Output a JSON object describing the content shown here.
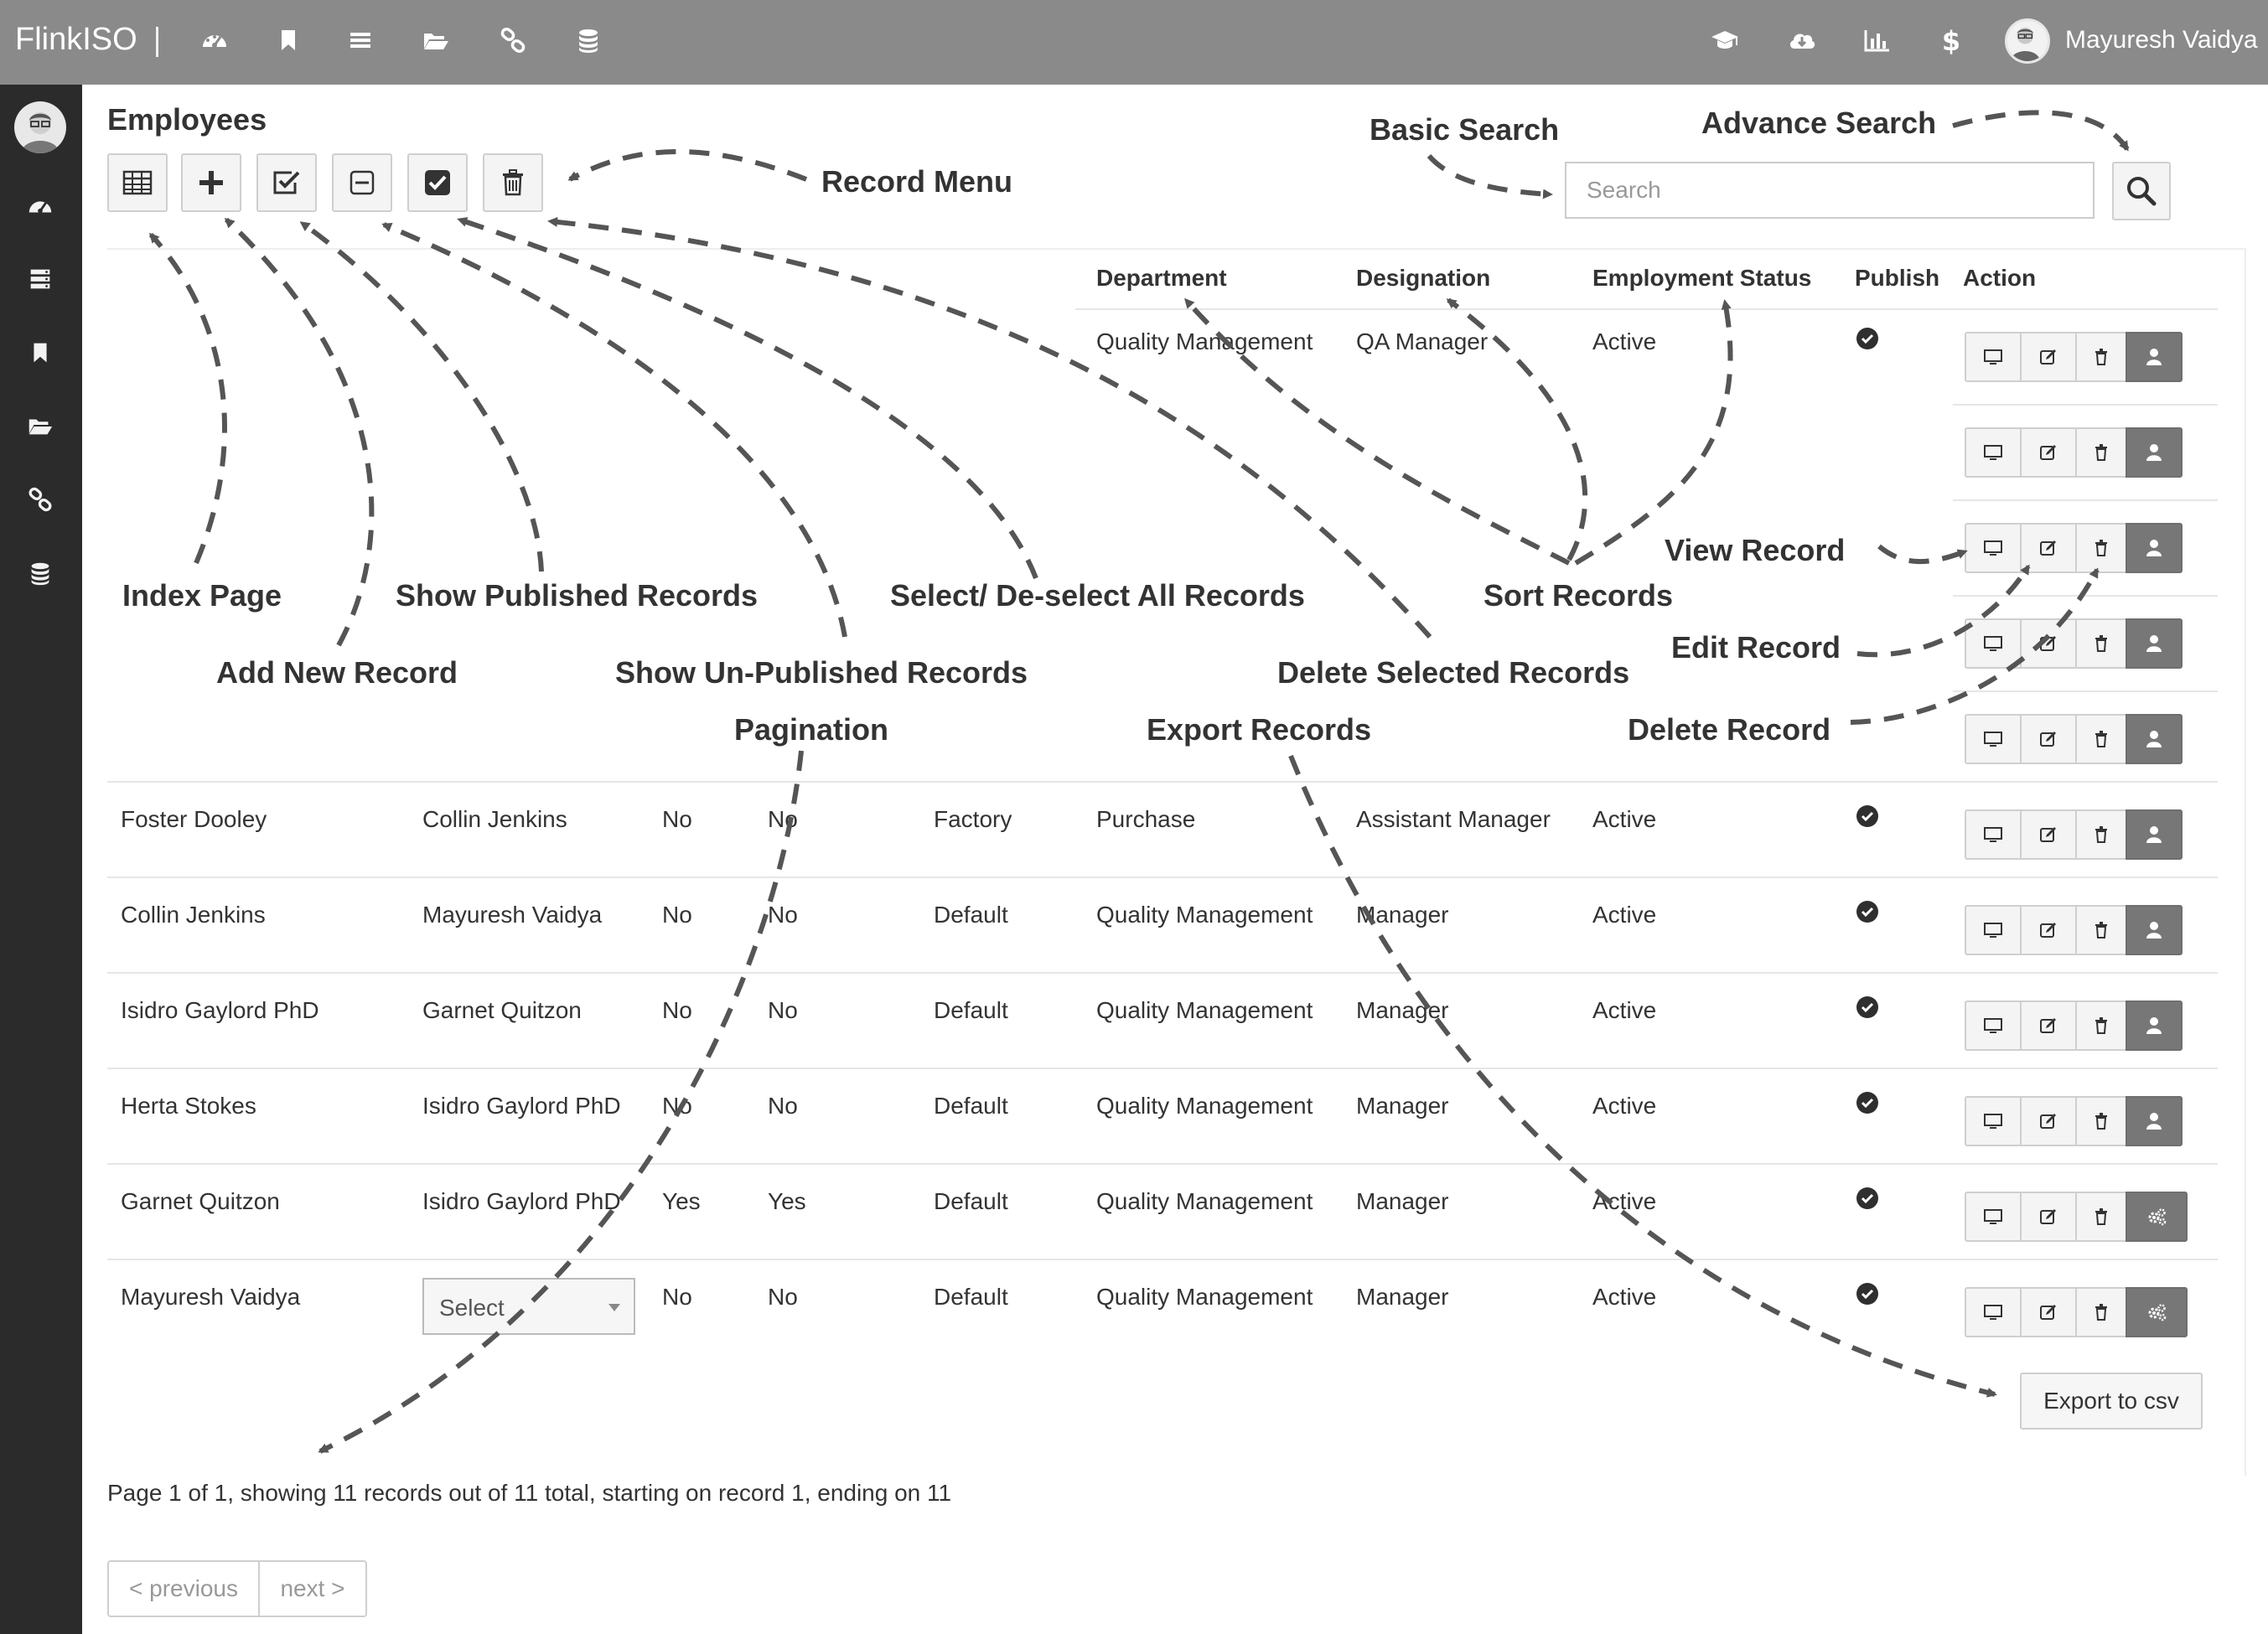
{
  "app": {
    "brand": "FlinkISO",
    "user_name": "Mayuresh Vaidya"
  },
  "topbar_icons": [
    "dashboard-icon",
    "bookmark-icon",
    "list-icon",
    "folder-open-icon",
    "link-icon",
    "database-icon"
  ],
  "topbar_right_icons": [
    "graduation-cap-icon",
    "cloud-download-icon",
    "bar-chart-icon",
    "dollar-icon"
  ],
  "sidebar_icons": [
    "dashboard-icon",
    "server-icon",
    "bookmark-icon",
    "folder-open-icon",
    "link-icon",
    "database-icon"
  ],
  "page": {
    "title": "Employees"
  },
  "toolbar": [
    "table-icon",
    "plus-icon",
    "check-square-icon",
    "minus-square-icon",
    "check-filled-icon",
    "trash-icon"
  ],
  "search": {
    "placeholder": "Search"
  },
  "table": {
    "headers": [
      "Department",
      "Designation",
      "Employment Status",
      "Publish",
      "Action"
    ],
    "top_row": {
      "department": "Quality Management",
      "designation": "QA Manager",
      "status": "Active"
    },
    "rows": [
      {
        "name": "Foster Dooley",
        "reports_to": "Collin Jenkins",
        "c1": "No",
        "c2": "No",
        "branch": "Factory",
        "department": "Purchase",
        "designation": "Assistant Manager",
        "status": "Active"
      },
      {
        "name": "Collin Jenkins",
        "reports_to": "Mayuresh Vaidya",
        "c1": "No",
        "c2": "No",
        "branch": "Default",
        "department": "Quality Management",
        "designation": "Manager",
        "status": "Active"
      },
      {
        "name": "Isidro Gaylord PhD",
        "reports_to": "Garnet Quitzon",
        "c1": "No",
        "c2": "No",
        "branch": "Default",
        "department": "Quality Management",
        "designation": "Manager",
        "status": "Active"
      },
      {
        "name": "Herta Stokes",
        "reports_to": "Isidro Gaylord PhD",
        "c1": "No",
        "c2": "No",
        "branch": "Default",
        "department": "Quality Management",
        "designation": "Manager",
        "status": "Active"
      },
      {
        "name": "Garnet Quitzon",
        "reports_to": "Isidro Gaylord PhD",
        "c1": "Yes",
        "c2": "Yes",
        "branch": "Default",
        "department": "Quality Management",
        "designation": "Manager",
        "status": "Active"
      },
      {
        "name": "Mayuresh Vaidya",
        "reports_to": "",
        "c1": "No",
        "c2": "No",
        "branch": "Default",
        "department": "Quality Management",
        "designation": "Manager",
        "status": "Active"
      }
    ],
    "select_placeholder": "Select"
  },
  "export_label": "Export to csv",
  "pagination": {
    "summary": "Page 1 of 1, showing 11 records out of 11 total, starting on record 1, ending on 11",
    "previous": "< previous",
    "next": "next >"
  },
  "annotations": {
    "record_menu": "Record Menu",
    "basic_search": "Basic Search",
    "advance_search": "Advance Search",
    "index_page": "Index Page",
    "show_published": "Show Published Records",
    "select_all": "Select/ De-select All Records",
    "sort_records": "Sort Records",
    "view_record": "View Record",
    "add_new": "Add New Record",
    "show_unpublished": "Show Un-Published Records",
    "delete_selected": "Delete Selected Records",
    "edit_record": "Edit Record",
    "pagination": "Pagination",
    "export_records": "Export Records",
    "delete_record": "Delete Record"
  }
}
